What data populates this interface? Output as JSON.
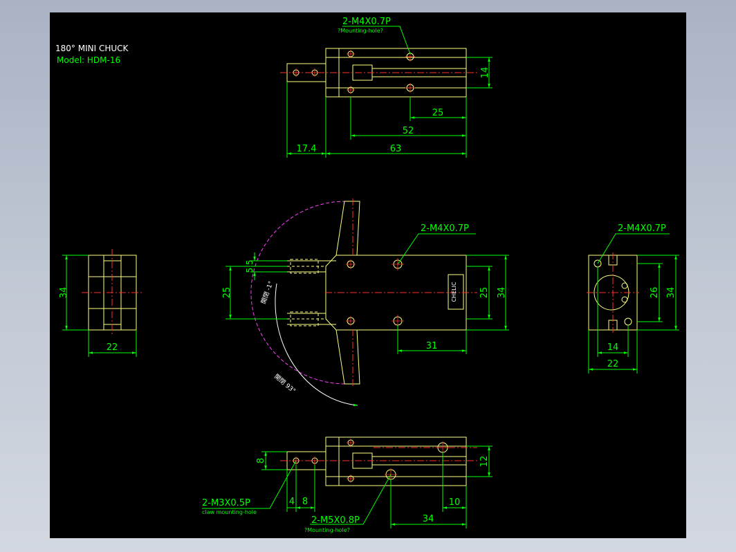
{
  "title_block": {
    "title": "180° MINI CHUCK",
    "model": "Model: HDM-16"
  },
  "top_view": {
    "callout_thread": "2-M4X0.7P",
    "callout_note": "?Mounting-hole?",
    "dim_height": "14",
    "dim_hole_spacing": "25",
    "dim_hole_to_end": "52",
    "dim_jaw_ext": "17.4",
    "dim_body_length": "63"
  },
  "front_view": {
    "callout_thread": "2-M4X0.7P",
    "dim_jaw_slot": "5.5",
    "dim_jaw_spacing": "25",
    "dim_body_height_inner": "25",
    "dim_body_height": "34",
    "dim_hole_offset": "31",
    "arc_label_small": "開閉 -1°",
    "arc_label_large": "開閉 93°",
    "logo_text": "CHELIC"
  },
  "left_view": {
    "dim_height": "34",
    "dim_width": "22"
  },
  "right_view": {
    "callout_thread": "2-M4X0.7P",
    "dim_height_inner": "26",
    "dim_height": "34",
    "dim_hole_spacing": "14",
    "dim_width": "22"
  },
  "bottom_view": {
    "dim_jaw_height": "8",
    "dim_height": "12",
    "dim_4": "4",
    "dim_8": "8",
    "dim_10": "10",
    "dim_34": "34",
    "callout_claw_thread": "2-M3X0.5P",
    "callout_claw_note": "claw mounting-hole",
    "callout_mount_thread": "2-M5X0.8P",
    "callout_mount_note": "?Mounting-hole?"
  },
  "colors": {
    "background": "#000000",
    "outline": "#ffff80",
    "dimension": "#00ff00",
    "centerline": "#ff3030",
    "arc": "#ff40ff",
    "text": "#ffffff"
  }
}
